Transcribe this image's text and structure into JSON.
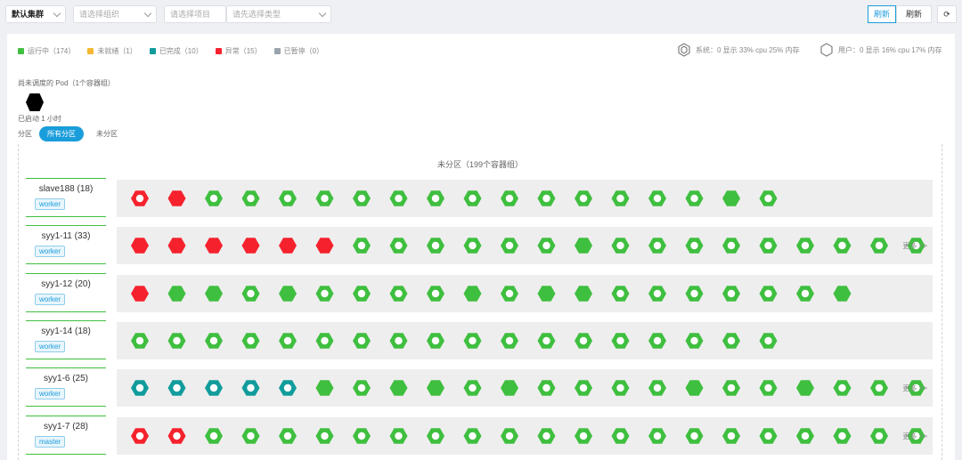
{
  "toolbar": {
    "cluster_select": "默认集群",
    "group_select": "请选择组织",
    "project_select": "请选择项目",
    "type_select": "请先选择类型",
    "btn_new": "刷新",
    "btn_refresh": "刷新",
    "btn_sync": "⟳"
  },
  "legend": [
    {
      "label": "运行中（174）",
      "color": "#3fbf3f"
    },
    {
      "label": "未就绪（1）",
      "color": "#f5b731"
    },
    {
      "label": "已完成（10）",
      "color": "#129c9c"
    },
    {
      "label": "异常（15）",
      "color": "#f5222d"
    },
    {
      "label": "已暂停（0）",
      "color": "#9aa3ad"
    }
  ],
  "sys": {
    "system_text": "系统：0 显示  33% cpu  25% 内存",
    "user_text": "用户：0 显示  16% cpu  17% 内存"
  },
  "unscheduled": {
    "title": "尚未调度的 Pod（1个容器组）",
    "caption": "已启动 1 小时"
  },
  "tabs": {
    "label": "分区",
    "all": "所有分区",
    "none": "未分区"
  },
  "panel_title": "未分区（199个容器组）",
  "more_label": "更多 >>",
  "colors": {
    "green": "#3fbf3f",
    "red": "#f5222d",
    "teal": "#129c9c"
  },
  "nodes": [
    {
      "name": "slave188 (18)",
      "tag": "worker",
      "more": false,
      "pods": [
        "ro",
        "rf",
        "go",
        "go",
        "go",
        "go",
        "go",
        "go",
        "go",
        "go",
        "go",
        "go",
        "go",
        "go",
        "go",
        "go",
        "gf",
        "go"
      ]
    },
    {
      "name": "syy1-11 (33)",
      "tag": "worker",
      "more": true,
      "pods": [
        "rf",
        "rf",
        "rf",
        "rf",
        "rf",
        "rf",
        "go",
        "go",
        "go",
        "go",
        "go",
        "go",
        "gf",
        "go",
        "go",
        "go",
        "go",
        "go",
        "go",
        "go",
        "go",
        "go"
      ]
    },
    {
      "name": "syy1-12 (20)",
      "tag": "worker",
      "more": false,
      "pods": [
        "rf",
        "gf",
        "gf",
        "go",
        "gf",
        "go",
        "go",
        "go",
        "go",
        "gf",
        "go",
        "gf",
        "gf",
        "go",
        "go",
        "go",
        "go",
        "go",
        "go",
        "gf"
      ]
    },
    {
      "name": "syy1-14 (18)",
      "tag": "worker",
      "more": false,
      "pods": [
        "go",
        "go",
        "go",
        "go",
        "go",
        "go",
        "go",
        "go",
        "go",
        "go",
        "go",
        "go",
        "go",
        "go",
        "go",
        "go",
        "go",
        "go"
      ]
    },
    {
      "name": "syy1-6 (25)",
      "tag": "worker",
      "more": true,
      "pods": [
        "to",
        "to",
        "to",
        "to",
        "to",
        "gf",
        "go",
        "gf",
        "gf",
        "go",
        "gf",
        "go",
        "go",
        "go",
        "go",
        "gf",
        "go",
        "go",
        "gf",
        "go",
        "go",
        "go"
      ]
    },
    {
      "name": "syy1-7 (28)",
      "tag": "master",
      "more": true,
      "pods": [
        "ro",
        "ro",
        "go",
        "go",
        "go",
        "go",
        "go",
        "go",
        "go",
        "go",
        "go",
        "go",
        "go",
        "go",
        "go",
        "go",
        "go",
        "go",
        "go",
        "go",
        "go",
        "go"
      ]
    }
  ]
}
